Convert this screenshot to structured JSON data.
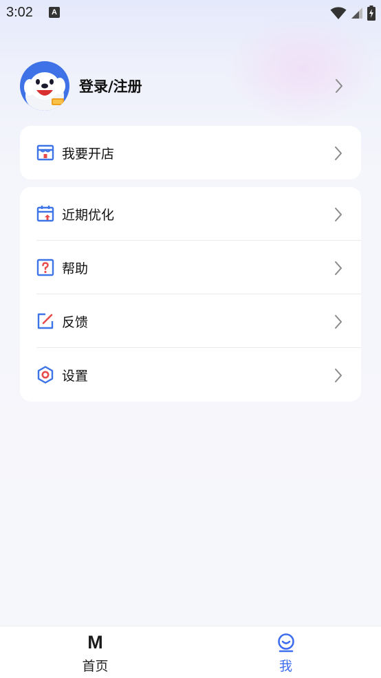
{
  "status_bar": {
    "time": "3:02",
    "notification_badge": "A"
  },
  "profile": {
    "login_label": "登录/注册"
  },
  "shop_card": {
    "label": "我要开店",
    "icon": "store-icon"
  },
  "menu": [
    {
      "label": "近期优化",
      "icon": "calendar-upgrade-icon"
    },
    {
      "label": "帮助",
      "icon": "help-icon"
    },
    {
      "label": "反馈",
      "icon": "feedback-edit-icon"
    },
    {
      "label": "设置",
      "icon": "settings-hexagon-icon"
    }
  ],
  "tabbar": {
    "home_label": "首页",
    "home_icon_text": "M",
    "me_label": "我",
    "active_tab": "me"
  },
  "colors": {
    "accent": "#3e6df0",
    "icon_blue": "#3d74e8",
    "icon_red": "#e84b4b",
    "text": "#111111",
    "chevron": "#8a8a8a"
  }
}
